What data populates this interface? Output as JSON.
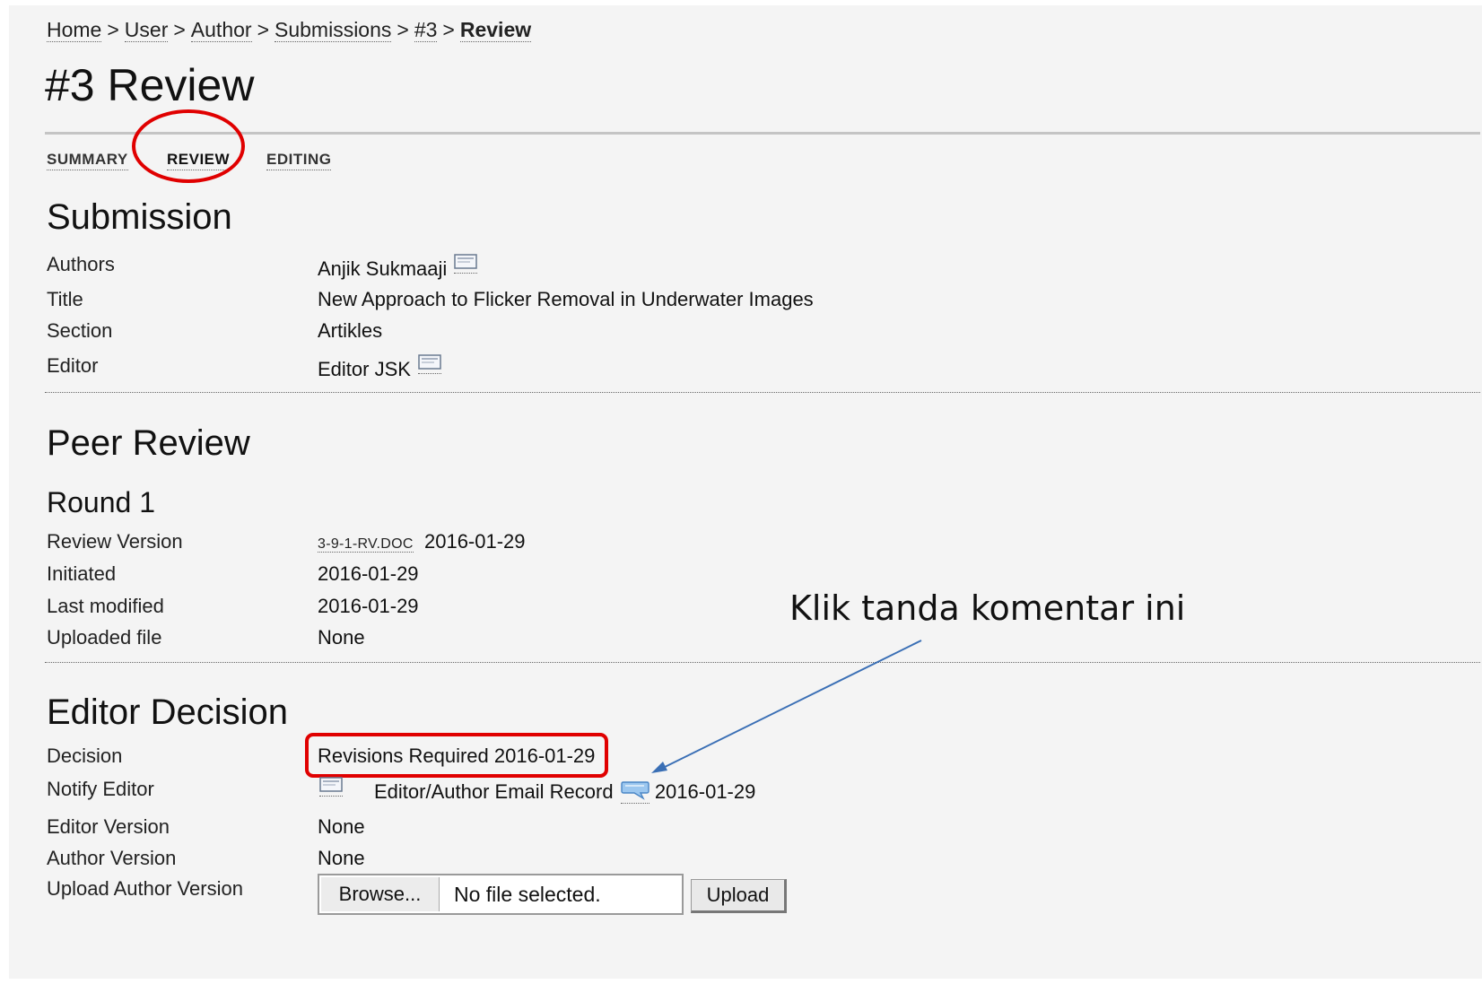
{
  "breadcrumb": [
    "Home",
    "User",
    "Author",
    "Submissions",
    "#3",
    "Review"
  ],
  "breadcrumb_separator": ">",
  "page_title": "#3 Review",
  "tabs": [
    "SUMMARY",
    "REVIEW",
    "EDITING"
  ],
  "active_tab": "REVIEW",
  "submission": {
    "heading": "Submission",
    "authors_label": "Authors",
    "authors_value": "Anjik Sukmaaji",
    "title_label": "Title",
    "title_value": "New Approach to Flicker Removal in Underwater Images",
    "section_label": "Section",
    "section_value": "Artikles",
    "editor_label": "Editor",
    "editor_value": "Editor JSK"
  },
  "peer_review": {
    "heading": "Peer Review",
    "round": "Round 1",
    "review_version_label": "Review Version",
    "review_version_file": "3-9-1-RV.DOC",
    "review_version_date": "2016-01-29",
    "initiated_label": "Initiated",
    "initiated_value": "2016-01-29",
    "last_modified_label": "Last modified",
    "last_modified_value": "2016-01-29",
    "uploaded_file_label": "Uploaded file",
    "uploaded_file_value": "None"
  },
  "editor_decision": {
    "heading": "Editor Decision",
    "decision_label": "Decision",
    "decision_value": "Revisions Required 2016-01-29",
    "notify_label": "Notify Editor",
    "email_record": "Editor/Author Email Record",
    "notify_date": "2016-01-29",
    "editor_version_label": "Editor Version",
    "editor_version_value": "None",
    "author_version_label": "Author Version",
    "author_version_value": "None",
    "upload_label": "Upload Author Version",
    "browse_label": "Browse...",
    "no_file_text": "No file selected.",
    "upload_button": "Upload"
  },
  "annotation": {
    "text": "Klik tanda komentar ini",
    "highlight_color": "#e00000",
    "arrow_color": "#3a6fb5"
  },
  "icons": {
    "envelope": "envelope-icon",
    "comment": "comment-bubble-icon"
  }
}
